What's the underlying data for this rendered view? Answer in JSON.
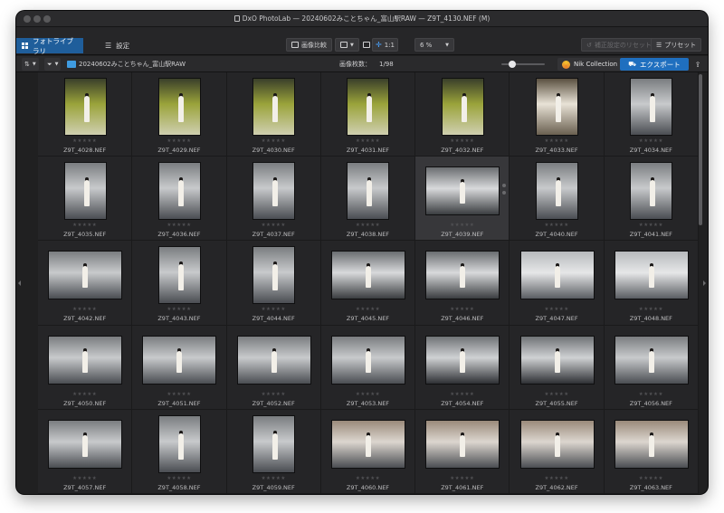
{
  "window": {
    "title": "DxO PhotoLab — 20240602みことちゃん_富山駅RAW — Z9T_4130.NEF (M)"
  },
  "toolbar": {
    "tab_library": "フォトライブラリ",
    "tab_settings": "設定",
    "compare_label": "画像比較",
    "zoom_1to1": "1:1",
    "zoom_percent": "6 %",
    "reset_label": "補正設定のリセット",
    "preset_label": "プリセット"
  },
  "filterbar": {
    "folder_name": "20240602みことちゃん_富山駅RAW",
    "count_label": "画像枚数：",
    "count_value": "1/98",
    "nik_label": "Nik Collection",
    "export_label": "エクスポート"
  },
  "colors": {
    "accent": "#1f5e9b",
    "export": "#1f6fbf",
    "background": "#202021"
  },
  "thumbnails": [
    {
      "name": "Z9T_4028.NEF",
      "stars": "★★★★★",
      "orientation": "portrait",
      "scene": "escalator"
    },
    {
      "name": "Z9T_4029.NEF",
      "stars": "★★★★★",
      "orientation": "portrait",
      "scene": "escalator"
    },
    {
      "name": "Z9T_4030.NEF",
      "stars": "★★★★★",
      "orientation": "portrait",
      "scene": "escalator"
    },
    {
      "name": "Z9T_4031.NEF",
      "stars": "★★★★★",
      "orientation": "portrait",
      "scene": "escalator"
    },
    {
      "name": "Z9T_4032.NEF",
      "stars": "★★★★★",
      "orientation": "portrait",
      "scene": "escalator"
    },
    {
      "name": "Z9T_4033.NEF",
      "stars": "★★★★★",
      "orientation": "portrait",
      "scene": "closeup"
    },
    {
      "name": "Z9T_4034.NEF",
      "stars": "★★★★★",
      "orientation": "portrait",
      "scene": "platform"
    },
    {
      "name": "Z9T_4035.NEF",
      "stars": "★★★★★",
      "orientation": "portrait",
      "scene": "platform"
    },
    {
      "name": "Z9T_4036.NEF",
      "stars": "★★★★★",
      "orientation": "portrait",
      "scene": "platform"
    },
    {
      "name": "Z9T_4037.NEF",
      "stars": "★★★★★",
      "orientation": "portrait",
      "scene": "platform"
    },
    {
      "name": "Z9T_4038.NEF",
      "stars": "★★★★★",
      "orientation": "portrait",
      "scene": "platform"
    },
    {
      "name": "Z9T_4039.NEF",
      "stars": "★★★★★",
      "orientation": "landscape",
      "scene": "station"
    },
    {
      "name": "Z9T_4040.NEF",
      "stars": "★★★★★",
      "orientation": "portrait",
      "scene": "platform"
    },
    {
      "name": "Z9T_4041.NEF",
      "stars": "★★★★★",
      "orientation": "portrait",
      "scene": "platform"
    },
    {
      "name": "Z9T_4042.NEF",
      "stars": "★★★★★",
      "orientation": "landscape",
      "scene": "platform"
    },
    {
      "name": "Z9T_4043.NEF",
      "stars": "★★★★★",
      "orientation": "portrait",
      "scene": "platform"
    },
    {
      "name": "Z9T_4044.NEF",
      "stars": "★★★★★",
      "orientation": "portrait",
      "scene": "platform"
    },
    {
      "name": "Z9T_4045.NEF",
      "stars": "★★★★★",
      "orientation": "landscape",
      "scene": "station"
    },
    {
      "name": "Z9T_4046.NEF",
      "stars": "★★★★★",
      "orientation": "landscape",
      "scene": "station"
    },
    {
      "name": "Z9T_4047.NEF",
      "stars": "★★★★★",
      "orientation": "landscape",
      "scene": "train"
    },
    {
      "name": "Z9T_4048.NEF",
      "stars": "★★★★★",
      "orientation": "landscape",
      "scene": "train"
    },
    {
      "name": "Z9T_4050.NEF",
      "stars": "★★★★★",
      "orientation": "landscape",
      "scene": "platform"
    },
    {
      "name": "Z9T_4051.NEF",
      "stars": "★★★★★",
      "orientation": "landscape",
      "scene": "platform"
    },
    {
      "name": "Z9T_4052.NEF",
      "stars": "★★★★★",
      "orientation": "landscape",
      "scene": "platform"
    },
    {
      "name": "Z9T_4053.NEF",
      "stars": "★★★★★",
      "orientation": "landscape",
      "scene": "platform"
    },
    {
      "name": "Z9T_4054.NEF",
      "stars": "★★★★★",
      "orientation": "landscape",
      "scene": "bench"
    },
    {
      "name": "Z9T_4055.NEF",
      "stars": "★★★★★",
      "orientation": "landscape",
      "scene": "bench"
    },
    {
      "name": "Z9T_4056.NEF",
      "stars": "★★★★★",
      "orientation": "landscape",
      "scene": "platform"
    },
    {
      "name": "Z9T_4057.NEF",
      "stars": "★★★★★",
      "orientation": "landscape",
      "scene": "platform"
    },
    {
      "name": "Z9T_4058.NEF",
      "stars": "★★★★★",
      "orientation": "portrait",
      "scene": "platform"
    },
    {
      "name": "Z9T_4059.NEF",
      "stars": "★★★★★",
      "orientation": "portrait",
      "scene": "platform"
    },
    {
      "name": "Z9T_4060.NEF",
      "stars": "★★★★★",
      "orientation": "landscape",
      "scene": "motion"
    },
    {
      "name": "Z9T_4061.NEF",
      "stars": "★★★★★",
      "orientation": "landscape",
      "scene": "motion"
    },
    {
      "name": "Z9T_4062.NEF",
      "stars": "★★★★★",
      "orientation": "landscape",
      "scene": "motion"
    },
    {
      "name": "Z9T_4063.NEF",
      "stars": "★★★★★",
      "orientation": "landscape",
      "scene": "motion"
    }
  ],
  "selected_index": 11
}
